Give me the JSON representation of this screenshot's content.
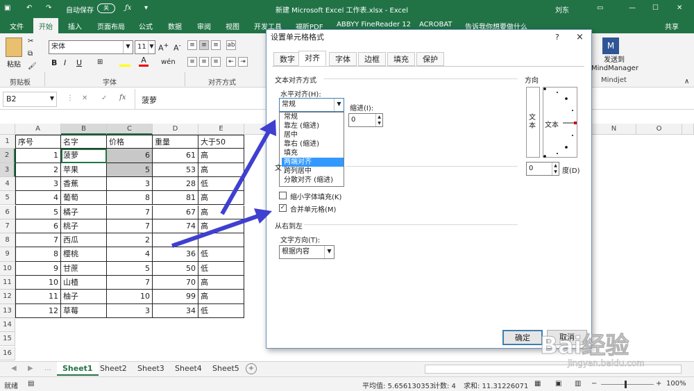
{
  "titlebar": {
    "autosave": "自动保存",
    "autosave_state": "关",
    "title": "新建 Microsoft Excel 工作表.xlsx  -  Excel",
    "user": "刘东"
  },
  "tabs": [
    "文件",
    "开始",
    "插入",
    "页面布局",
    "公式",
    "数据",
    "审阅",
    "视图",
    "开发工具",
    "福昕PDF",
    "ABBYY FineReader 12",
    "ACROBAT",
    "告诉我你想要做什么",
    "共享"
  ],
  "ribbon": {
    "paste": "粘贴",
    "clipboard": "剪贴板",
    "font_name": "宋体",
    "font_size": "11",
    "font_group": "字体",
    "align_group": "对齐方式",
    "mindmanager": "发送到\nMindManager",
    "mindjet": "Mindjet",
    "bold": "B",
    "italic": "I",
    "underline": "U"
  },
  "formula": {
    "namebox": "B2",
    "fx": "fx",
    "value": "菠萝"
  },
  "columns": [
    "A",
    "B",
    "C",
    "D",
    "E",
    "N",
    "O"
  ],
  "rows": [
    [
      "序号",
      "名字",
      "价格",
      "重量",
      "大于50"
    ],
    [
      "1",
      "菠萝",
      "6",
      "61",
      "高"
    ],
    [
      "2",
      "苹果",
      "5",
      "53",
      "高"
    ],
    [
      "3",
      "香蕉",
      "3",
      "28",
      "低"
    ],
    [
      "4",
      "葡萄",
      "8",
      "81",
      "高"
    ],
    [
      "5",
      "橘子",
      "7",
      "67",
      "高"
    ],
    [
      "6",
      "桃子",
      "7",
      "74",
      "高"
    ],
    [
      "7",
      "西瓜",
      "2",
      "",
      ""
    ],
    [
      "8",
      "樱桃",
      "4",
      "36",
      "低"
    ],
    [
      "9",
      "甘蔗",
      "5",
      "50",
      "低"
    ],
    [
      "10",
      "山楂",
      "7",
      "70",
      "高"
    ],
    [
      "11",
      "柚子",
      "10",
      "99",
      "高"
    ],
    [
      "12",
      "草莓",
      "3",
      "34",
      "低"
    ]
  ],
  "row_numbers": [
    "1",
    "2",
    "3",
    "4",
    "5",
    "6",
    "7",
    "8",
    "9",
    "10",
    "11",
    "12",
    "13",
    "14",
    "15",
    "16"
  ],
  "sheets": [
    "Sheet1",
    "Sheet2",
    "Sheet3",
    "Sheet4",
    "Sheet5"
  ],
  "status": {
    "ready": "就绪",
    "average": "平均值: 5.656130353",
    "count": "计数: 4",
    "sum": "求和: 11.31226071",
    "zoom": "100%"
  },
  "dialog": {
    "title": "设置单元格格式",
    "help": "?",
    "close": "×",
    "tabs": [
      "数字",
      "对齐",
      "字体",
      "边框",
      "填充",
      "保护"
    ],
    "text_align": "文本对齐方式",
    "horizontal": "水平对齐(H):",
    "horizontal_value": "常规",
    "indent": "缩进(I):",
    "indent_value": "0",
    "h_options": [
      "常规",
      "靠左 (缩进)",
      "居中",
      "靠右 (缩进)",
      "填充",
      "两端对齐",
      "跨列居中",
      "分散对齐 (缩进)"
    ],
    "h_selected": 5,
    "text_ctrl": "文",
    "shrink": "缩小字体填充(K)",
    "merge": "合并单元格(M)",
    "rtl": "从右到左",
    "text_dir": "文字方向(T):",
    "text_dir_value": "根据内容",
    "orientation": "方向",
    "orient_text": "文本",
    "orient_text2": "文本",
    "degree_value": "0",
    "degree": "度(D)",
    "ok": "确定",
    "cancel": "取消"
  },
  "watermark": {
    "brand": "Bai经验",
    "url": "jingyan.baidu.com"
  }
}
